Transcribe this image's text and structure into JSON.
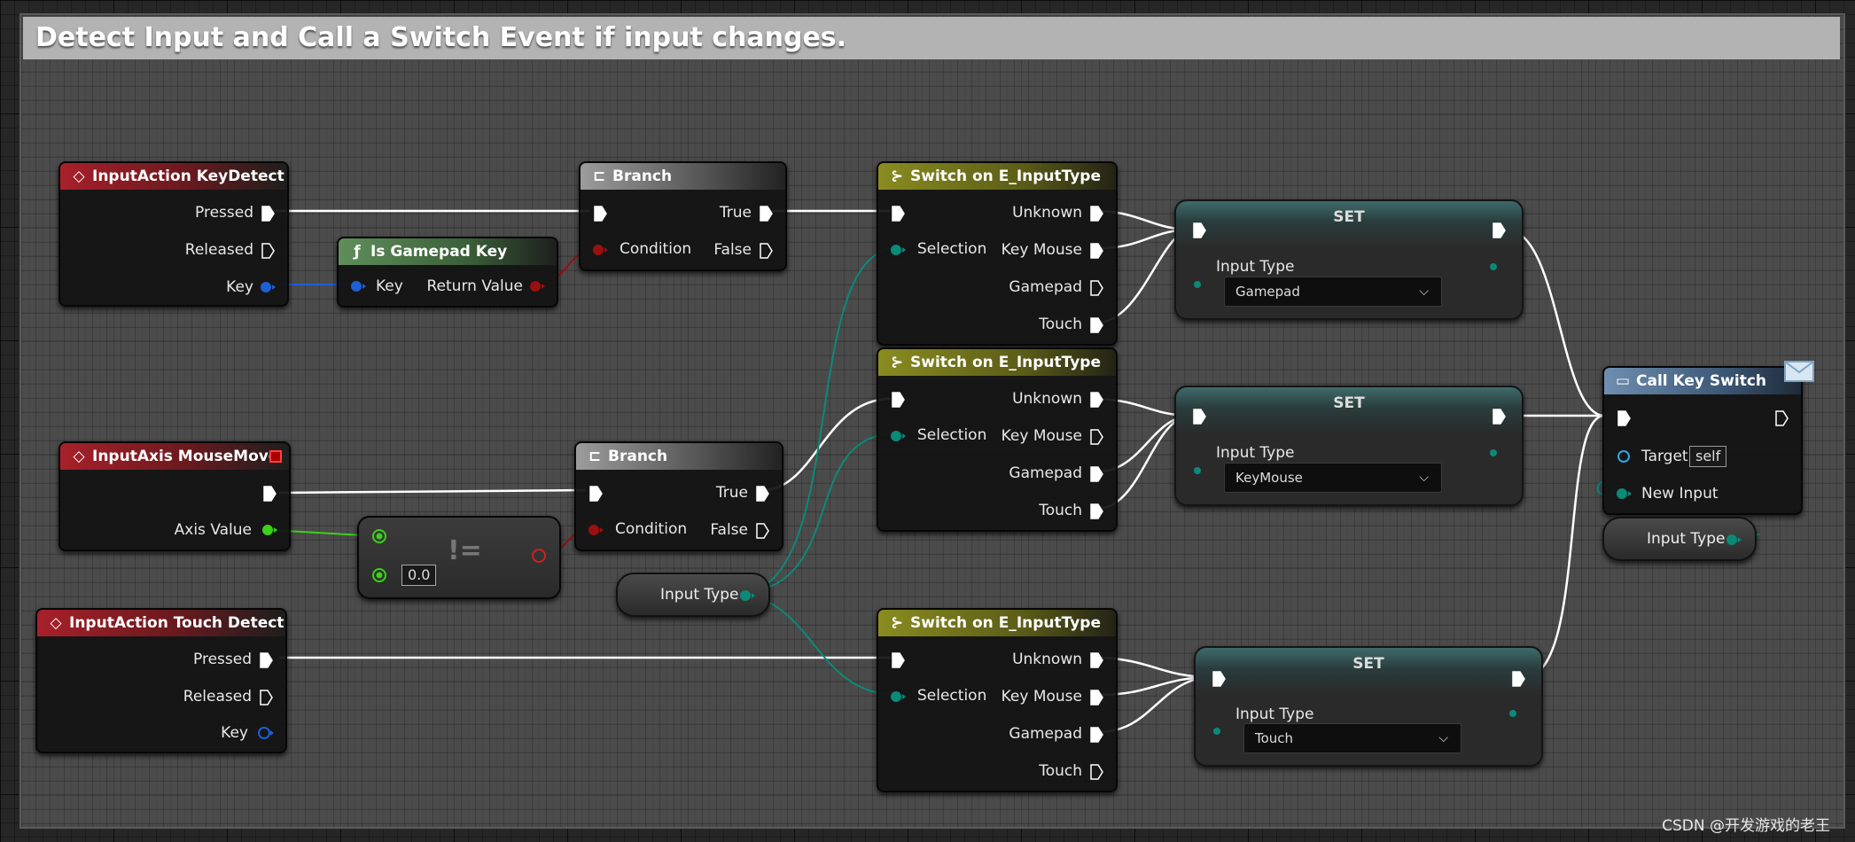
{
  "comment": {
    "title": "Detect Input and Call a Switch Event if input changes."
  },
  "nodes": {
    "input_action_key_detect": {
      "title": "InputAction KeyDetect",
      "pins": {
        "pressed": "Pressed",
        "released": "Released",
        "key": "Key"
      }
    },
    "is_gamepad_key": {
      "title": "Is Gamepad Key",
      "pins": {
        "key": "Key",
        "return_value": "Return Value"
      }
    },
    "branch_1": {
      "title": "Branch",
      "pins": {
        "condition": "Condition",
        "true": "True",
        "false": "False"
      }
    },
    "input_axis_mouse_move": {
      "title": "InputAxis MouseMove",
      "pins": {
        "axis_value": "Axis Value"
      }
    },
    "not_equal": {
      "operator": "!=",
      "default_value": "0.0"
    },
    "branch_2": {
      "title": "Branch",
      "pins": {
        "condition": "Condition",
        "true": "True",
        "false": "False"
      }
    },
    "input_type_getter": {
      "label": "Input Type"
    },
    "input_action_touch_detect": {
      "title": "InputAction Touch Detect",
      "pins": {
        "pressed": "Pressed",
        "released": "Released",
        "key": "Key"
      }
    },
    "switch_1": {
      "title": "Switch on E_InputType",
      "pins": {
        "selection": "Selection",
        "unknown": "Unknown",
        "key_mouse": "Key Mouse",
        "gamepad": "Gamepad",
        "touch": "Touch"
      }
    },
    "switch_2": {
      "title": "Switch on E_InputType",
      "pins": {
        "selection": "Selection",
        "unknown": "Unknown",
        "key_mouse": "Key Mouse",
        "gamepad": "Gamepad",
        "touch": "Touch"
      }
    },
    "switch_3": {
      "title": "Switch on E_InputType",
      "pins": {
        "selection": "Selection",
        "unknown": "Unknown",
        "key_mouse": "Key Mouse",
        "gamepad": "Gamepad",
        "touch": "Touch"
      }
    },
    "set_1": {
      "title": "SET",
      "pin": "Input Type",
      "value": "Gamepad"
    },
    "set_2": {
      "title": "SET",
      "pin": "Input Type",
      "value": "KeyMouse"
    },
    "set_3": {
      "title": "SET",
      "pin": "Input Type",
      "value": "Touch"
    },
    "call_key_switch": {
      "title": "Call Key Switch",
      "pins": {
        "target": "Target",
        "target_value": "self",
        "new_input": "New Input"
      }
    },
    "input_type_getter_2": {
      "label": "Input Type"
    }
  },
  "watermark": "CSDN @开发游戏的老王",
  "colors": {
    "exec": "#ffffff",
    "bool": "#9a0f0f",
    "float": "#3bd11a",
    "struct_key": "#1e5fd4",
    "enum": "#0a8a78",
    "object": "#2aa8e8",
    "event_header": "#a8202a",
    "function_header": "#5f8f5b",
    "branch_header": "#9c9c9c",
    "switch_header": "#8a8c20",
    "call_header": "#6f8eb0"
  }
}
